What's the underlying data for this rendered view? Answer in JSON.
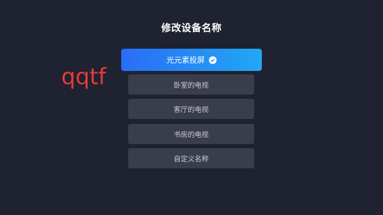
{
  "dialog": {
    "title": "修改设备名称"
  },
  "watermark": "qqtf",
  "options": [
    {
      "label": "光元素投屏",
      "selected": true
    },
    {
      "label": "卧室的电视",
      "selected": false
    },
    {
      "label": "客厅的电视",
      "selected": false
    },
    {
      "label": "书房的电视",
      "selected": false
    },
    {
      "label": "自定义名称",
      "selected": false
    }
  ],
  "colors": {
    "background": "#1f2230",
    "selected_gradient_start": "#2a6df6",
    "selected_gradient_end": "#21a8f3",
    "option_background": "#3a3d4a",
    "watermark": "#e63b3b"
  },
  "icons": {
    "selected_indicator": "check-circle-icon"
  }
}
